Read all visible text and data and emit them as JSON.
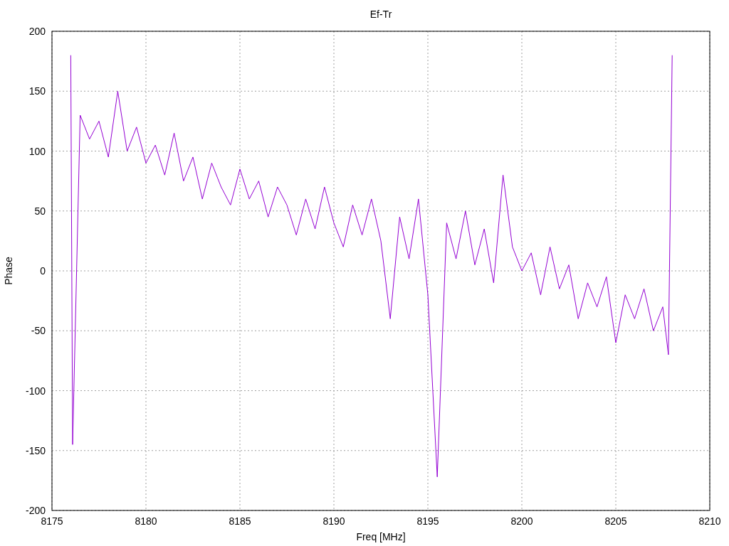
{
  "chart_data": {
    "type": "line",
    "title": "Ef-Tr",
    "xlabel": "Freq [MHz]",
    "ylabel": "Phase",
    "grid": true,
    "xlim": [
      8175,
      8210
    ],
    "ylim": [
      -200,
      200
    ],
    "xticks": [
      8175,
      8180,
      8185,
      8190,
      8195,
      8200,
      8205,
      8210
    ],
    "yticks": [
      -200,
      -150,
      -100,
      -50,
      0,
      50,
      100,
      150,
      200
    ],
    "x": [
      8176,
      8176.1,
      8176.5,
      8177,
      8177.5,
      8178,
      8178.5,
      8179,
      8179.5,
      8180,
      8180.5,
      8181,
      8181.5,
      8182,
      8182.5,
      8183,
      8183.5,
      8184,
      8184.5,
      8185,
      8185.5,
      8186,
      8186.5,
      8187,
      8187.5,
      8188,
      8188.5,
      8189,
      8189.5,
      8190,
      8190.5,
      8191,
      8191.5,
      8192,
      8192.5,
      8193,
      8193.5,
      8194,
      8194.5,
      8195,
      8195.5,
      8196,
      8196.5,
      8197,
      8197.5,
      8198,
      8198.5,
      8199,
      8199.5,
      8200,
      8200.5,
      8201,
      8201.5,
      8202,
      8202.5,
      8203,
      8203.5,
      8204,
      8204.5,
      8205,
      8205.5,
      8206,
      8206.5,
      8207,
      8207.5,
      8207.8,
      8208
    ],
    "series": [
      {
        "color": "#9400d3",
        "values": [
          180,
          -145,
          130,
          110,
          125,
          95,
          150,
          100,
          120,
          90,
          105,
          80,
          115,
          75,
          95,
          60,
          90,
          70,
          55,
          85,
          60,
          75,
          45,
          70,
          55,
          30,
          60,
          35,
          70,
          40,
          20,
          55,
          30,
          60,
          25,
          -40,
          45,
          10,
          60,
          -20,
          -172,
          40,
          10,
          50,
          5,
          35,
          -10,
          80,
          20,
          0,
          15,
          -20,
          20,
          -15,
          5,
          -40,
          -10,
          -30,
          -5,
          -60,
          -20,
          -40,
          -15,
          -50,
          -30,
          -70,
          180
        ]
      }
    ]
  }
}
